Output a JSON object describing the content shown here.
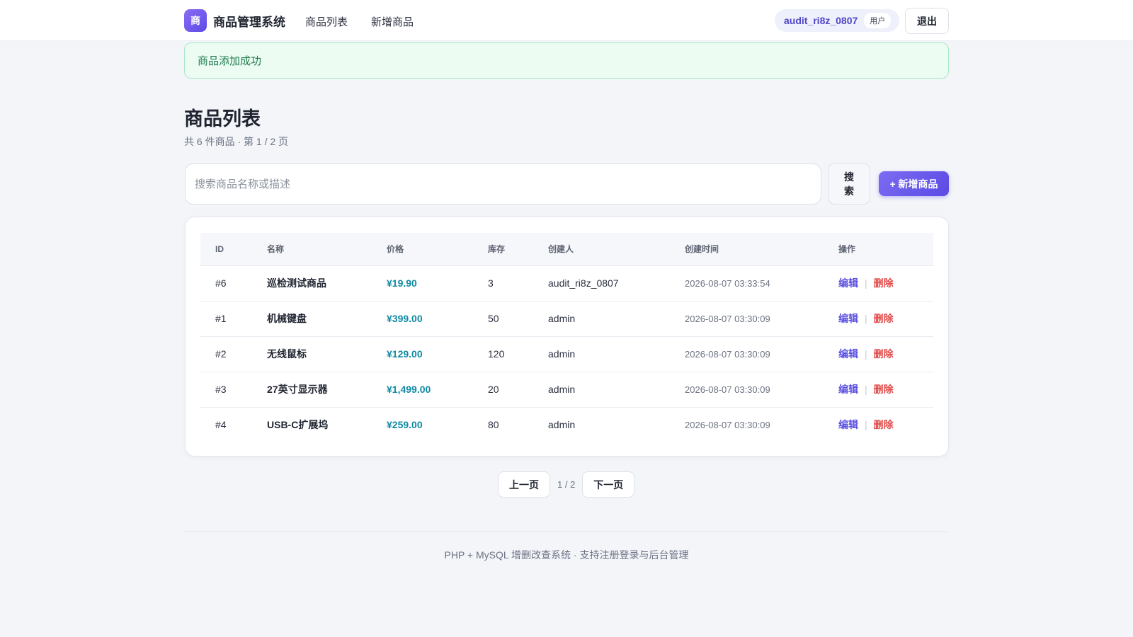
{
  "brand": {
    "logo_char": "商",
    "name": "商品管理系统"
  },
  "nav": {
    "items": [
      "商品列表",
      "新增商品"
    ]
  },
  "user": {
    "name": "audit_ri8z_0807",
    "role": "用户",
    "logout_label": "退出"
  },
  "alert": {
    "message": "商品添加成功",
    "type": "success"
  },
  "page": {
    "title": "商品列表",
    "subtitle": "共 6 件商品 · 第 1 / 2 页"
  },
  "search": {
    "placeholder": "搜索商品名称或描述",
    "value": "",
    "button_label": "搜索"
  },
  "add_button_label": "+ 新增商品",
  "table": {
    "columns": [
      "ID",
      "名称",
      "价格",
      "库存",
      "创建人",
      "创建时间",
      "操作"
    ],
    "rows": [
      {
        "id": "#6",
        "name": "巡检测试商品",
        "price": "¥19.90",
        "stock": "3",
        "creator": "audit_ri8z_0807",
        "created": "2026-08-07 03:33:54"
      },
      {
        "id": "#1",
        "name": "机械键盘",
        "price": "¥399.00",
        "stock": "50",
        "creator": "admin",
        "created": "2026-08-07 03:30:09"
      },
      {
        "id": "#2",
        "name": "无线鼠标",
        "price": "¥129.00",
        "stock": "120",
        "creator": "admin",
        "created": "2026-08-07 03:30:09"
      },
      {
        "id": "#3",
        "name": "27英寸显示器",
        "price": "¥1,499.00",
        "stock": "20",
        "creator": "admin",
        "created": "2026-08-07 03:30:09"
      },
      {
        "id": "#4",
        "name": "USB-C扩展坞",
        "price": "¥259.00",
        "stock": "80",
        "creator": "admin",
        "created": "2026-08-07 03:30:09"
      }
    ],
    "actions": {
      "edit": "编辑",
      "separator": "|",
      "delete": "删除"
    }
  },
  "pagination": {
    "prev_label": "上一页",
    "info": "1 / 2",
    "next_label": "下一页"
  },
  "footer": {
    "text": "PHP + MySQL 增删改查系统 · 支持注册登录与后台管理"
  },
  "colors": {
    "accent": "#5b4ce6",
    "price": "#0f8aa3",
    "danger": "#e14a4a",
    "success_bg": "#ecfcf3"
  }
}
